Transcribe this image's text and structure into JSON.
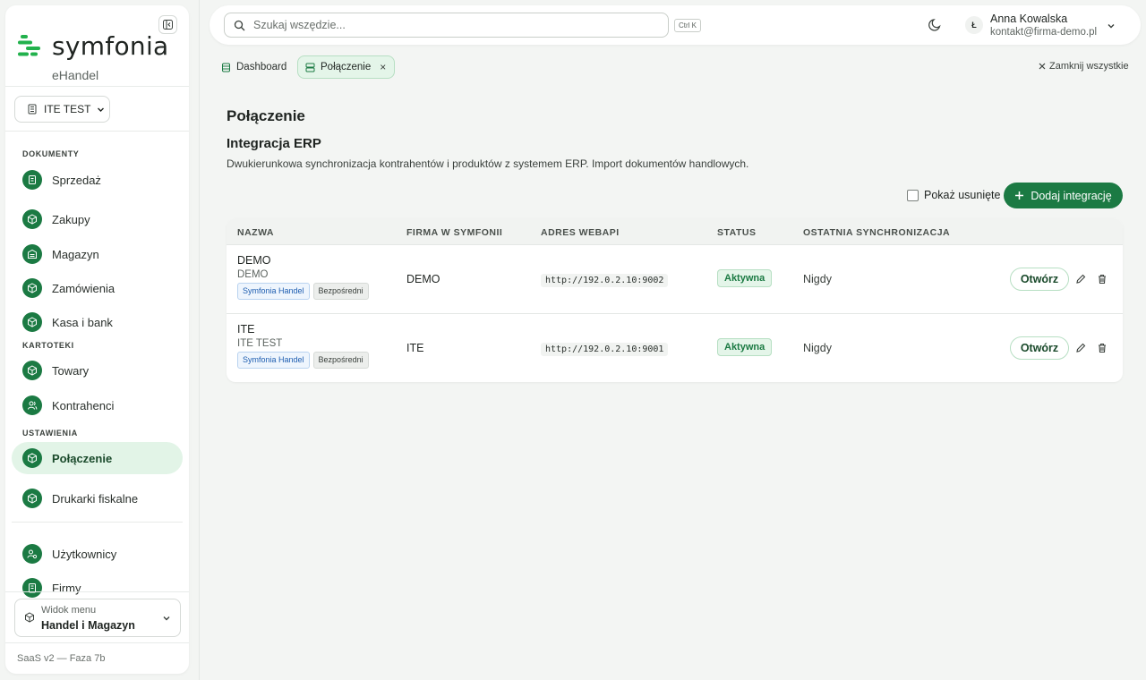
{
  "brand": {
    "name": "symfonia",
    "product": "eHandel",
    "accent_color": "#1b7a43"
  },
  "sidebar": {
    "company": "ITE TEST",
    "sections": [
      {
        "label": "DOKUMENTY",
        "items": [
          "Sprzedaż",
          "Zakupy",
          "Magazyn",
          "Zamówienia",
          "Kasa i bank"
        ]
      },
      {
        "label": "KARTOTEKI",
        "items": [
          "Towary",
          "Kontrahenci"
        ]
      },
      {
        "label": "USTAWIENIA",
        "items": [
          "Połączenie",
          "Drukarki fiskalne"
        ]
      }
    ],
    "extra_items": [
      "Użytkownicy",
      "Firmy"
    ],
    "active_item": "Połączenie",
    "view_menu": {
      "label": "Widok menu",
      "value": "Handel i Magazyn"
    },
    "footer": "SaaS v2 — Faza 7b"
  },
  "topbar": {
    "search_placeholder": "Szukaj wszędzie...",
    "shortcut": "Ctrl K",
    "user": {
      "initial": "Ł",
      "name": "Anna Kowalska",
      "email": "kontakt@firma-demo.pl"
    }
  },
  "tabs": [
    {
      "label": "Dashboard",
      "icon": "database-icon",
      "active": false
    },
    {
      "label": "Połączenie",
      "icon": "server-icon",
      "active": true,
      "close": "×"
    }
  ],
  "close_all": "Zamknij wszystkie",
  "page": {
    "title": "Połączenie",
    "section_title": "Integracja ERP",
    "section_desc": "Dwukierunkowa synchronizacja kontrahentów i produktów z systemem ERP. Import dokumentów handlowych.",
    "show_deleted": "Pokaż usunięte",
    "add_button": "Dodaj integrację"
  },
  "table": {
    "columns": [
      "NAZWA",
      "FIRMA W SYMFONII",
      "ADRES WEBAPI",
      "STATUS",
      "OSTATNIA SYNCHRONIZACJA"
    ],
    "rows": [
      {
        "name": "DEMO",
        "sub": "DEMO",
        "tags": [
          "Symfonia Handel",
          "Bezpośredni"
        ],
        "firm": "DEMO",
        "url": "http://192.0.2.10:9002",
        "status": "Aktywna",
        "last_sync": "Nigdy",
        "open": "Otwórz"
      },
      {
        "name": "ITE",
        "sub": "ITE TEST",
        "tags": [
          "Symfonia Handel",
          "Bezpośredni"
        ],
        "firm": "ITE",
        "url": "http://192.0.2.10:9001",
        "status": "Aktywna",
        "last_sync": "Nigdy",
        "open": "Otwórz"
      }
    ]
  }
}
